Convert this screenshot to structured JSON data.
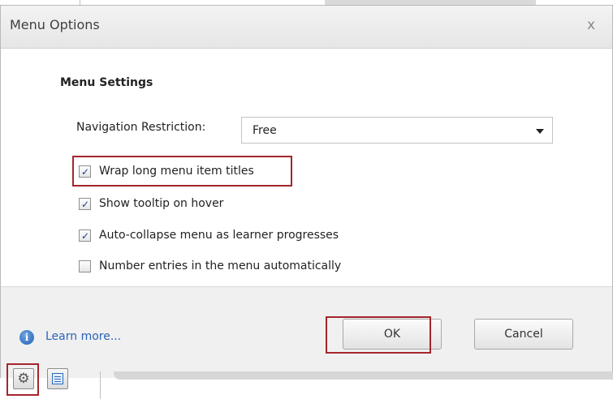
{
  "dialog": {
    "title": "Menu Options",
    "close_glyph": "x",
    "section_heading": "Menu Settings",
    "navigation": {
      "label": "Navigation Restriction:",
      "selected": "Free"
    },
    "options": [
      {
        "label": "Wrap long menu item titles",
        "checked": true,
        "highlighted": true
      },
      {
        "label": "Show tooltip on hover",
        "checked": true,
        "highlighted": false
      },
      {
        "label": "Auto-collapse menu as learner progresses",
        "checked": true,
        "highlighted": false
      },
      {
        "label": "Number entries in the menu automatically",
        "checked": false,
        "highlighted": false
      }
    ],
    "footer": {
      "learn_more": "Learn more...",
      "ok_label": "OK",
      "cancel_label": "Cancel"
    }
  },
  "toolbar": {
    "icons": [
      "gear-icon",
      "menu-list-icon"
    ]
  },
  "colors": {
    "highlight": "#a4262c",
    "link": "#2b63b8",
    "checkmark": "#1d3f88"
  }
}
